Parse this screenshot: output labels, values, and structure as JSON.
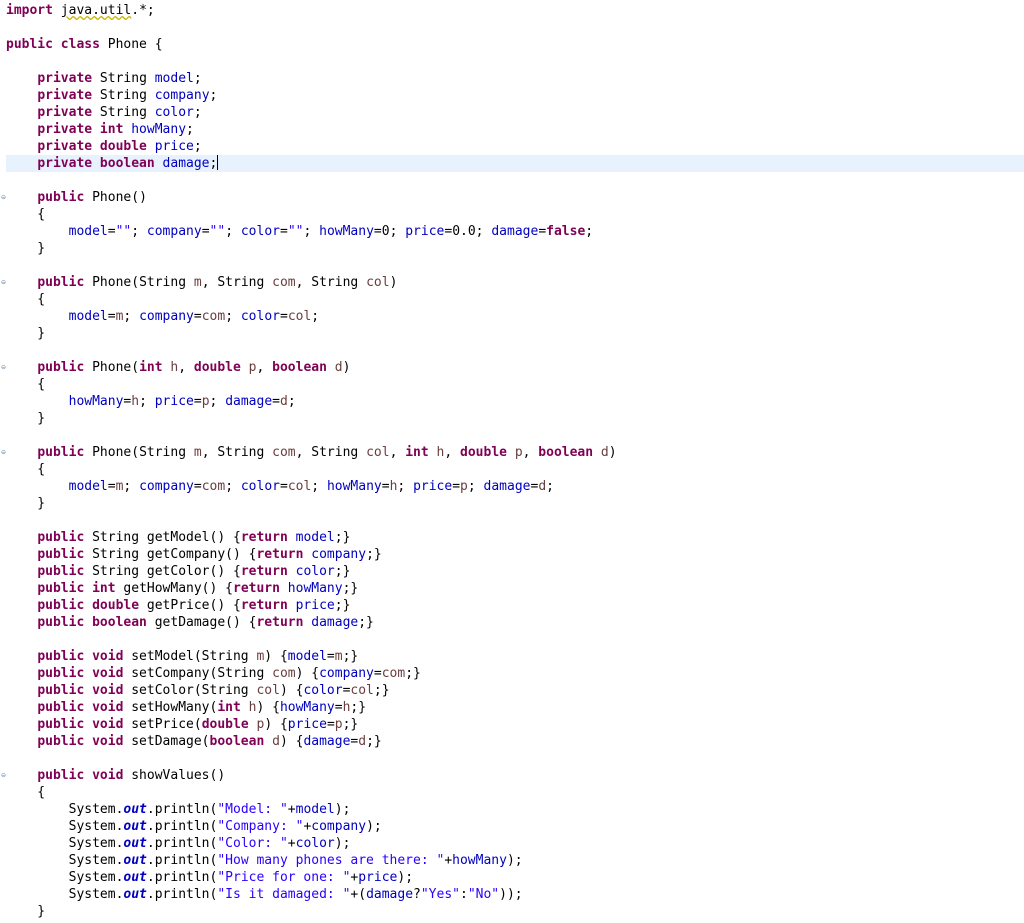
{
  "editor": {
    "caret_line": 9,
    "lines": [
      [
        [
          "kw",
          "import"
        ],
        [
          "p",
          " "
        ],
        [
          "sq",
          "java.util"
        ],
        [
          "p",
          ".*;"
        ]
      ],
      [],
      [
        [
          "kw",
          "public class"
        ],
        [
          "p",
          " Phone {"
        ]
      ],
      [],
      [
        [
          "p",
          "    "
        ],
        [
          "kw",
          "private"
        ],
        [
          "p",
          " String "
        ],
        [
          "fld",
          "model"
        ],
        [
          "p",
          ";"
        ]
      ],
      [
        [
          "p",
          "    "
        ],
        [
          "kw",
          "private"
        ],
        [
          "p",
          " String "
        ],
        [
          "fld",
          "company"
        ],
        [
          "p",
          ";"
        ]
      ],
      [
        [
          "p",
          "    "
        ],
        [
          "kw",
          "private"
        ],
        [
          "p",
          " String "
        ],
        [
          "fld",
          "color"
        ],
        [
          "p",
          ";"
        ]
      ],
      [
        [
          "p",
          "    "
        ],
        [
          "kw",
          "private int"
        ],
        [
          "p",
          " "
        ],
        [
          "fld",
          "howMany"
        ],
        [
          "p",
          ";"
        ]
      ],
      [
        [
          "p",
          "    "
        ],
        [
          "kw",
          "private double"
        ],
        [
          "p",
          " "
        ],
        [
          "fld",
          "price"
        ],
        [
          "p",
          ";"
        ]
      ],
      [
        [
          "p",
          "    "
        ],
        [
          "kw",
          "private boolean"
        ],
        [
          "p",
          " "
        ],
        [
          "fld",
          "damage"
        ],
        [
          "p",
          ";"
        ]
      ],
      [],
      [
        [
          "p",
          "    "
        ],
        [
          "kw",
          "public"
        ],
        [
          "p",
          " Phone()"
        ]
      ],
      [
        [
          "p",
          "    {"
        ]
      ],
      [
        [
          "p",
          "        "
        ],
        [
          "fld",
          "model"
        ],
        [
          "p",
          "="
        ],
        [
          "str",
          "\"\""
        ],
        [
          "p",
          "; "
        ],
        [
          "fld",
          "company"
        ],
        [
          "p",
          "="
        ],
        [
          "str",
          "\"\""
        ],
        [
          "p",
          "; "
        ],
        [
          "fld",
          "color"
        ],
        [
          "p",
          "="
        ],
        [
          "str",
          "\"\""
        ],
        [
          "p",
          "; "
        ],
        [
          "fld",
          "howMany"
        ],
        [
          "p",
          "=0; "
        ],
        [
          "fld",
          "price"
        ],
        [
          "p",
          "=0.0; "
        ],
        [
          "fld",
          "damage"
        ],
        [
          "p",
          "="
        ],
        [
          "kw",
          "false"
        ],
        [
          "p",
          ";"
        ]
      ],
      [
        [
          "p",
          "    }"
        ]
      ],
      [],
      [
        [
          "p",
          "    "
        ],
        [
          "kw",
          "public"
        ],
        [
          "p",
          " Phone(String "
        ],
        [
          "loc",
          "m"
        ],
        [
          "p",
          ", String "
        ],
        [
          "loc",
          "com"
        ],
        [
          "p",
          ", String "
        ],
        [
          "loc",
          "col"
        ],
        [
          "p",
          ")"
        ]
      ],
      [
        [
          "p",
          "    {"
        ]
      ],
      [
        [
          "p",
          "        "
        ],
        [
          "fld",
          "model"
        ],
        [
          "p",
          "="
        ],
        [
          "loc",
          "m"
        ],
        [
          "p",
          "; "
        ],
        [
          "fld",
          "company"
        ],
        [
          "p",
          "="
        ],
        [
          "loc",
          "com"
        ],
        [
          "p",
          "; "
        ],
        [
          "fld",
          "color"
        ],
        [
          "p",
          "="
        ],
        [
          "loc",
          "col"
        ],
        [
          "p",
          ";"
        ]
      ],
      [
        [
          "p",
          "    }"
        ]
      ],
      [],
      [
        [
          "p",
          "    "
        ],
        [
          "kw",
          "public"
        ],
        [
          "p",
          " Phone("
        ],
        [
          "kw",
          "int"
        ],
        [
          "p",
          " "
        ],
        [
          "loc",
          "h"
        ],
        [
          "p",
          ", "
        ],
        [
          "kw",
          "double"
        ],
        [
          "p",
          " "
        ],
        [
          "loc",
          "p"
        ],
        [
          "p",
          ", "
        ],
        [
          "kw",
          "boolean"
        ],
        [
          "p",
          " "
        ],
        [
          "loc",
          "d"
        ],
        [
          "p",
          ")"
        ]
      ],
      [
        [
          "p",
          "    {"
        ]
      ],
      [
        [
          "p",
          "        "
        ],
        [
          "fld",
          "howMany"
        ],
        [
          "p",
          "="
        ],
        [
          "loc",
          "h"
        ],
        [
          "p",
          "; "
        ],
        [
          "fld",
          "price"
        ],
        [
          "p",
          "="
        ],
        [
          "loc",
          "p"
        ],
        [
          "p",
          "; "
        ],
        [
          "fld",
          "damage"
        ],
        [
          "p",
          "="
        ],
        [
          "loc",
          "d"
        ],
        [
          "p",
          ";"
        ]
      ],
      [
        [
          "p",
          "    }"
        ]
      ],
      [],
      [
        [
          "p",
          "    "
        ],
        [
          "kw",
          "public"
        ],
        [
          "p",
          " Phone(String "
        ],
        [
          "loc",
          "m"
        ],
        [
          "p",
          ", String "
        ],
        [
          "loc",
          "com"
        ],
        [
          "p",
          ", String "
        ],
        [
          "loc",
          "col"
        ],
        [
          "p",
          ", "
        ],
        [
          "kw",
          "int"
        ],
        [
          "p",
          " "
        ],
        [
          "loc",
          "h"
        ],
        [
          "p",
          ", "
        ],
        [
          "kw",
          "double"
        ],
        [
          "p",
          " "
        ],
        [
          "loc",
          "p"
        ],
        [
          "p",
          ", "
        ],
        [
          "kw",
          "boolean"
        ],
        [
          "p",
          " "
        ],
        [
          "loc",
          "d"
        ],
        [
          "p",
          ")"
        ]
      ],
      [
        [
          "p",
          "    {"
        ]
      ],
      [
        [
          "p",
          "        "
        ],
        [
          "fld",
          "model"
        ],
        [
          "p",
          "="
        ],
        [
          "loc",
          "m"
        ],
        [
          "p",
          "; "
        ],
        [
          "fld",
          "company"
        ],
        [
          "p",
          "="
        ],
        [
          "loc",
          "com"
        ],
        [
          "p",
          "; "
        ],
        [
          "fld",
          "color"
        ],
        [
          "p",
          "="
        ],
        [
          "loc",
          "col"
        ],
        [
          "p",
          "; "
        ],
        [
          "fld",
          "howMany"
        ],
        [
          "p",
          "="
        ],
        [
          "loc",
          "h"
        ],
        [
          "p",
          "; "
        ],
        [
          "fld",
          "price"
        ],
        [
          "p",
          "="
        ],
        [
          "loc",
          "p"
        ],
        [
          "p",
          "; "
        ],
        [
          "fld",
          "damage"
        ],
        [
          "p",
          "="
        ],
        [
          "loc",
          "d"
        ],
        [
          "p",
          ";"
        ]
      ],
      [
        [
          "p",
          "    }"
        ]
      ],
      [],
      [
        [
          "p",
          "    "
        ],
        [
          "kw",
          "public"
        ],
        [
          "p",
          " String getModel() {"
        ],
        [
          "kw",
          "return"
        ],
        [
          "p",
          " "
        ],
        [
          "fld",
          "model"
        ],
        [
          "p",
          ";}"
        ]
      ],
      [
        [
          "p",
          "    "
        ],
        [
          "kw",
          "public"
        ],
        [
          "p",
          " String getCompany() {"
        ],
        [
          "kw",
          "return"
        ],
        [
          "p",
          " "
        ],
        [
          "fld",
          "company"
        ],
        [
          "p",
          ";}"
        ]
      ],
      [
        [
          "p",
          "    "
        ],
        [
          "kw",
          "public"
        ],
        [
          "p",
          " String getColor() {"
        ],
        [
          "kw",
          "return"
        ],
        [
          "p",
          " "
        ],
        [
          "fld",
          "color"
        ],
        [
          "p",
          ";}"
        ]
      ],
      [
        [
          "p",
          "    "
        ],
        [
          "kw",
          "public int"
        ],
        [
          "p",
          " getHowMany() {"
        ],
        [
          "kw",
          "return"
        ],
        [
          "p",
          " "
        ],
        [
          "fld",
          "howMany"
        ],
        [
          "p",
          ";}"
        ]
      ],
      [
        [
          "p",
          "    "
        ],
        [
          "kw",
          "public double"
        ],
        [
          "p",
          " getPrice() {"
        ],
        [
          "kw",
          "return"
        ],
        [
          "p",
          " "
        ],
        [
          "fld",
          "price"
        ],
        [
          "p",
          ";}"
        ]
      ],
      [
        [
          "p",
          "    "
        ],
        [
          "kw",
          "public boolean"
        ],
        [
          "p",
          " getDamage() {"
        ],
        [
          "kw",
          "return"
        ],
        [
          "p",
          " "
        ],
        [
          "fld",
          "damage"
        ],
        [
          "p",
          ";}"
        ]
      ],
      [],
      [
        [
          "p",
          "    "
        ],
        [
          "kw",
          "public void"
        ],
        [
          "p",
          " setModel(String "
        ],
        [
          "loc",
          "m"
        ],
        [
          "p",
          ") {"
        ],
        [
          "fld",
          "model"
        ],
        [
          "p",
          "="
        ],
        [
          "loc",
          "m"
        ],
        [
          "p",
          ";}"
        ]
      ],
      [
        [
          "p",
          "    "
        ],
        [
          "kw",
          "public void"
        ],
        [
          "p",
          " setCompany(String "
        ],
        [
          "loc",
          "com"
        ],
        [
          "p",
          ") {"
        ],
        [
          "fld",
          "company"
        ],
        [
          "p",
          "="
        ],
        [
          "loc",
          "com"
        ],
        [
          "p",
          ";}"
        ]
      ],
      [
        [
          "p",
          "    "
        ],
        [
          "kw",
          "public void"
        ],
        [
          "p",
          " setColor(String "
        ],
        [
          "loc",
          "col"
        ],
        [
          "p",
          ") {"
        ],
        [
          "fld",
          "color"
        ],
        [
          "p",
          "="
        ],
        [
          "loc",
          "col"
        ],
        [
          "p",
          ";}"
        ]
      ],
      [
        [
          "p",
          "    "
        ],
        [
          "kw",
          "public void"
        ],
        [
          "p",
          " setHowMany("
        ],
        [
          "kw",
          "int"
        ],
        [
          "p",
          " "
        ],
        [
          "loc",
          "h"
        ],
        [
          "p",
          ") {"
        ],
        [
          "fld",
          "howMany"
        ],
        [
          "p",
          "="
        ],
        [
          "loc",
          "h"
        ],
        [
          "p",
          ";}"
        ]
      ],
      [
        [
          "p",
          "    "
        ],
        [
          "kw",
          "public void"
        ],
        [
          "p",
          " setPrice("
        ],
        [
          "kw",
          "double"
        ],
        [
          "p",
          " "
        ],
        [
          "loc",
          "p"
        ],
        [
          "p",
          ") {"
        ],
        [
          "fld",
          "price"
        ],
        [
          "p",
          "="
        ],
        [
          "loc",
          "p"
        ],
        [
          "p",
          ";}"
        ]
      ],
      [
        [
          "p",
          "    "
        ],
        [
          "kw",
          "public void"
        ],
        [
          "p",
          " setDamage("
        ],
        [
          "kw",
          "boolean"
        ],
        [
          "p",
          " "
        ],
        [
          "loc",
          "d"
        ],
        [
          "p",
          ") {"
        ],
        [
          "fld",
          "damage"
        ],
        [
          "p",
          "="
        ],
        [
          "loc",
          "d"
        ],
        [
          "p",
          ";}"
        ]
      ],
      [],
      [
        [
          "p",
          "    "
        ],
        [
          "kw",
          "public void"
        ],
        [
          "p",
          " showValues()"
        ]
      ],
      [
        [
          "p",
          "    {"
        ]
      ],
      [
        [
          "p",
          "        System."
        ],
        [
          "stat",
          "out"
        ],
        [
          "p",
          ".println("
        ],
        [
          "str",
          "\"Model: \""
        ],
        [
          "p",
          "+"
        ],
        [
          "fld",
          "model"
        ],
        [
          "p",
          ");"
        ]
      ],
      [
        [
          "p",
          "        System."
        ],
        [
          "stat",
          "out"
        ],
        [
          "p",
          ".println("
        ],
        [
          "str",
          "\"Company: \""
        ],
        [
          "p",
          "+"
        ],
        [
          "fld",
          "company"
        ],
        [
          "p",
          ");"
        ]
      ],
      [
        [
          "p",
          "        System."
        ],
        [
          "stat",
          "out"
        ],
        [
          "p",
          ".println("
        ],
        [
          "str",
          "\"Color: \""
        ],
        [
          "p",
          "+"
        ],
        [
          "fld",
          "color"
        ],
        [
          "p",
          ");"
        ]
      ],
      [
        [
          "p",
          "        System."
        ],
        [
          "stat",
          "out"
        ],
        [
          "p",
          ".println("
        ],
        [
          "str",
          "\"How many phones are there: \""
        ],
        [
          "p",
          "+"
        ],
        [
          "fld",
          "howMany"
        ],
        [
          "p",
          ");"
        ]
      ],
      [
        [
          "p",
          "        System."
        ],
        [
          "stat",
          "out"
        ],
        [
          "p",
          ".println("
        ],
        [
          "str",
          "\"Price for one: \""
        ],
        [
          "p",
          "+"
        ],
        [
          "fld",
          "price"
        ],
        [
          "p",
          ");"
        ]
      ],
      [
        [
          "p",
          "        System."
        ],
        [
          "stat",
          "out"
        ],
        [
          "p",
          ".println("
        ],
        [
          "str",
          "\"Is it damaged: \""
        ],
        [
          "p",
          "+("
        ],
        [
          "fld",
          "damage"
        ],
        [
          "p",
          "?"
        ],
        [
          "str",
          "\"Yes\""
        ],
        [
          "p",
          ":"
        ],
        [
          "str",
          "\"No\""
        ],
        [
          "p",
          "));"
        ]
      ],
      [
        [
          "p",
          "    }"
        ]
      ]
    ]
  }
}
